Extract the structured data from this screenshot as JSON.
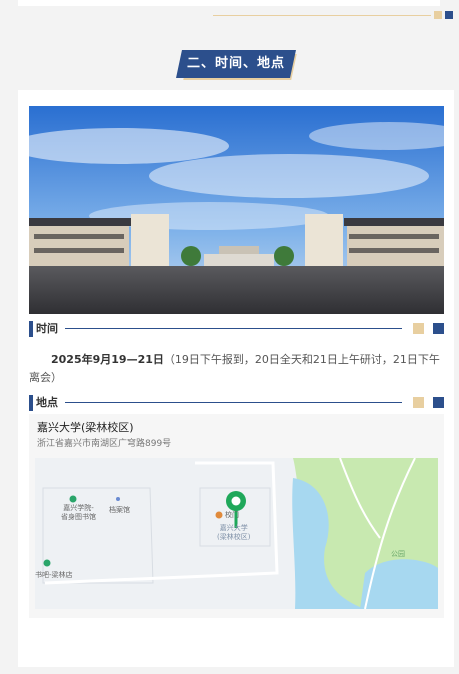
{
  "section": {
    "title": "二、时间、地点"
  },
  "time": {
    "label": "时间",
    "date": "2025年9月19—21日",
    "detail": "（19日下午报到，20日全天和21日上午研讨，21日下午离会）"
  },
  "location": {
    "label": "地点",
    "name": "嘉兴大学(梁林校区)",
    "address": "浙江省嘉兴市南湖区广穹路899号",
    "map_labels": {
      "library": "嘉兴学院-\n省身图书馆",
      "archive": "档案馆",
      "school_name": "嘉兴大学\n(梁林校区)",
      "bookstore": "书吧-梁林店",
      "gate": "校门",
      "park": "公园"
    }
  },
  "colors": {
    "accent": "#2c4f8c",
    "gold": "#e8cfa0",
    "pin": "#1fa85a",
    "map_green": "#c8e9b0",
    "map_water": "#a7d8f0"
  }
}
